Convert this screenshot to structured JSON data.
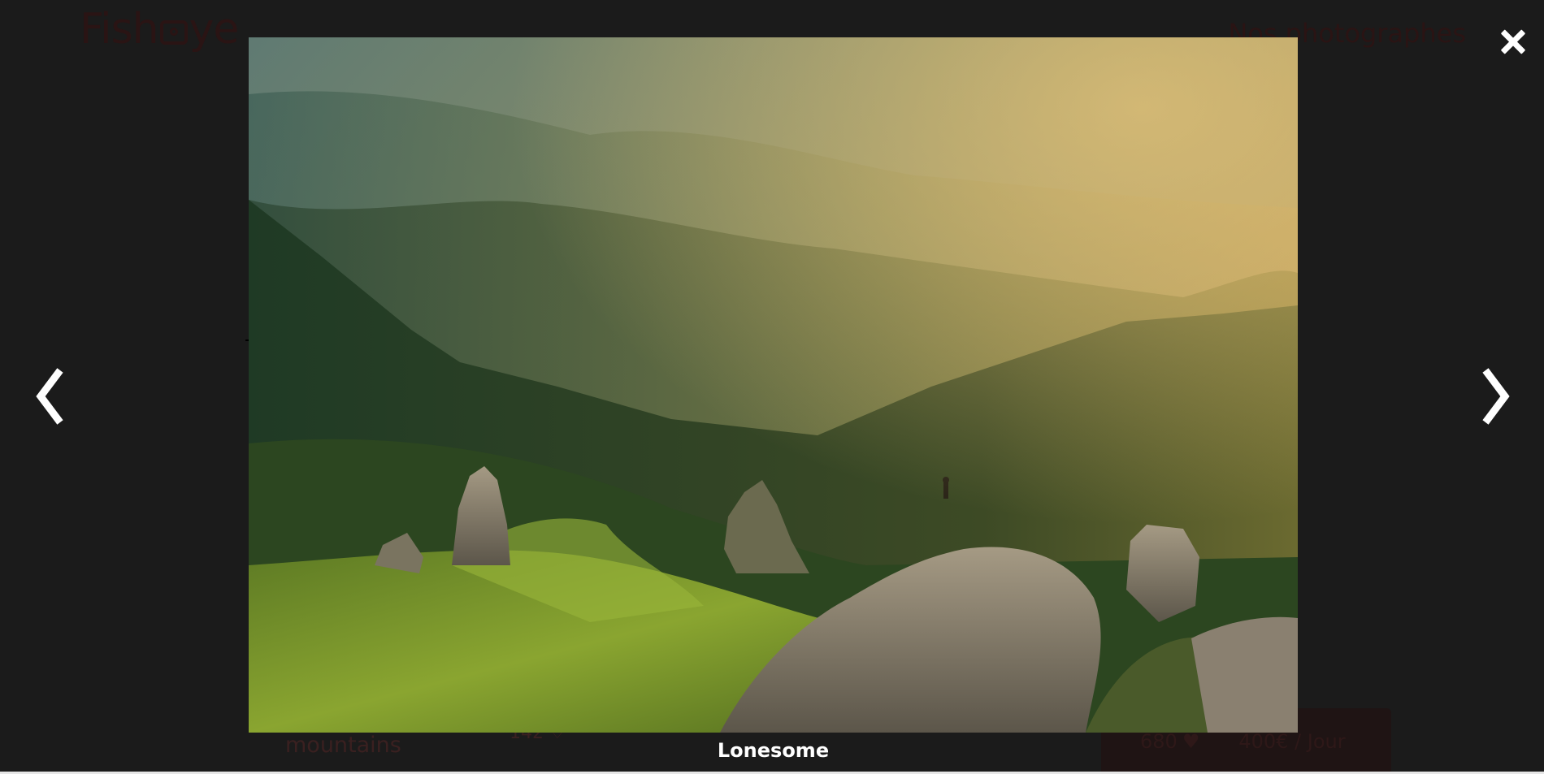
{
  "header": {
    "logo_left": "Fish",
    "logo_right": "ye",
    "nav_link": "Nos photographes"
  },
  "background_card": {
    "title": "mountains",
    "likes": "142"
  },
  "stats_bar": {
    "total_likes": "680",
    "price": "400€ / Jour"
  },
  "lightbox": {
    "caption": "Lonesome",
    "close_icon": "close-icon",
    "prev_icon": "chevron-left-icon",
    "next_icon": "chevron-right-icon"
  },
  "colors": {
    "overlay": "#1b1b1b",
    "brand": "#901c1c",
    "caption": "#ffffff"
  }
}
